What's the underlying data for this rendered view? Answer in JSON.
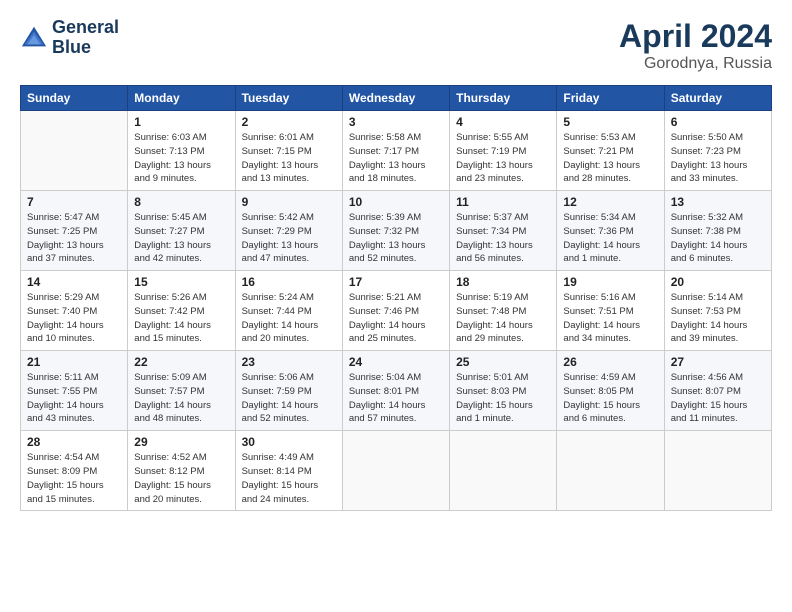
{
  "header": {
    "logo_line1": "General",
    "logo_line2": "Blue",
    "month": "April 2024",
    "location": "Gorodnya, Russia"
  },
  "weekdays": [
    "Sunday",
    "Monday",
    "Tuesday",
    "Wednesday",
    "Thursday",
    "Friday",
    "Saturday"
  ],
  "weeks": [
    [
      {
        "day": "",
        "info": ""
      },
      {
        "day": "1",
        "info": "Sunrise: 6:03 AM\nSunset: 7:13 PM\nDaylight: 13 hours\nand 9 minutes."
      },
      {
        "day": "2",
        "info": "Sunrise: 6:01 AM\nSunset: 7:15 PM\nDaylight: 13 hours\nand 13 minutes."
      },
      {
        "day": "3",
        "info": "Sunrise: 5:58 AM\nSunset: 7:17 PM\nDaylight: 13 hours\nand 18 minutes."
      },
      {
        "day": "4",
        "info": "Sunrise: 5:55 AM\nSunset: 7:19 PM\nDaylight: 13 hours\nand 23 minutes."
      },
      {
        "day": "5",
        "info": "Sunrise: 5:53 AM\nSunset: 7:21 PM\nDaylight: 13 hours\nand 28 minutes."
      },
      {
        "day": "6",
        "info": "Sunrise: 5:50 AM\nSunset: 7:23 PM\nDaylight: 13 hours\nand 33 minutes."
      }
    ],
    [
      {
        "day": "7",
        "info": "Sunrise: 5:47 AM\nSunset: 7:25 PM\nDaylight: 13 hours\nand 37 minutes."
      },
      {
        "day": "8",
        "info": "Sunrise: 5:45 AM\nSunset: 7:27 PM\nDaylight: 13 hours\nand 42 minutes."
      },
      {
        "day": "9",
        "info": "Sunrise: 5:42 AM\nSunset: 7:29 PM\nDaylight: 13 hours\nand 47 minutes."
      },
      {
        "day": "10",
        "info": "Sunrise: 5:39 AM\nSunset: 7:32 PM\nDaylight: 13 hours\nand 52 minutes."
      },
      {
        "day": "11",
        "info": "Sunrise: 5:37 AM\nSunset: 7:34 PM\nDaylight: 13 hours\nand 56 minutes."
      },
      {
        "day": "12",
        "info": "Sunrise: 5:34 AM\nSunset: 7:36 PM\nDaylight: 14 hours\nand 1 minute."
      },
      {
        "day": "13",
        "info": "Sunrise: 5:32 AM\nSunset: 7:38 PM\nDaylight: 14 hours\nand 6 minutes."
      }
    ],
    [
      {
        "day": "14",
        "info": "Sunrise: 5:29 AM\nSunset: 7:40 PM\nDaylight: 14 hours\nand 10 minutes."
      },
      {
        "day": "15",
        "info": "Sunrise: 5:26 AM\nSunset: 7:42 PM\nDaylight: 14 hours\nand 15 minutes."
      },
      {
        "day": "16",
        "info": "Sunrise: 5:24 AM\nSunset: 7:44 PM\nDaylight: 14 hours\nand 20 minutes."
      },
      {
        "day": "17",
        "info": "Sunrise: 5:21 AM\nSunset: 7:46 PM\nDaylight: 14 hours\nand 25 minutes."
      },
      {
        "day": "18",
        "info": "Sunrise: 5:19 AM\nSunset: 7:48 PM\nDaylight: 14 hours\nand 29 minutes."
      },
      {
        "day": "19",
        "info": "Sunrise: 5:16 AM\nSunset: 7:51 PM\nDaylight: 14 hours\nand 34 minutes."
      },
      {
        "day": "20",
        "info": "Sunrise: 5:14 AM\nSunset: 7:53 PM\nDaylight: 14 hours\nand 39 minutes."
      }
    ],
    [
      {
        "day": "21",
        "info": "Sunrise: 5:11 AM\nSunset: 7:55 PM\nDaylight: 14 hours\nand 43 minutes."
      },
      {
        "day": "22",
        "info": "Sunrise: 5:09 AM\nSunset: 7:57 PM\nDaylight: 14 hours\nand 48 minutes."
      },
      {
        "day": "23",
        "info": "Sunrise: 5:06 AM\nSunset: 7:59 PM\nDaylight: 14 hours\nand 52 minutes."
      },
      {
        "day": "24",
        "info": "Sunrise: 5:04 AM\nSunset: 8:01 PM\nDaylight: 14 hours\nand 57 minutes."
      },
      {
        "day": "25",
        "info": "Sunrise: 5:01 AM\nSunset: 8:03 PM\nDaylight: 15 hours\nand 1 minute."
      },
      {
        "day": "26",
        "info": "Sunrise: 4:59 AM\nSunset: 8:05 PM\nDaylight: 15 hours\nand 6 minutes."
      },
      {
        "day": "27",
        "info": "Sunrise: 4:56 AM\nSunset: 8:07 PM\nDaylight: 15 hours\nand 11 minutes."
      }
    ],
    [
      {
        "day": "28",
        "info": "Sunrise: 4:54 AM\nSunset: 8:09 PM\nDaylight: 15 hours\nand 15 minutes."
      },
      {
        "day": "29",
        "info": "Sunrise: 4:52 AM\nSunset: 8:12 PM\nDaylight: 15 hours\nand 20 minutes."
      },
      {
        "day": "30",
        "info": "Sunrise: 4:49 AM\nSunset: 8:14 PM\nDaylight: 15 hours\nand 24 minutes."
      },
      {
        "day": "",
        "info": ""
      },
      {
        "day": "",
        "info": ""
      },
      {
        "day": "",
        "info": ""
      },
      {
        "day": "",
        "info": ""
      }
    ]
  ]
}
